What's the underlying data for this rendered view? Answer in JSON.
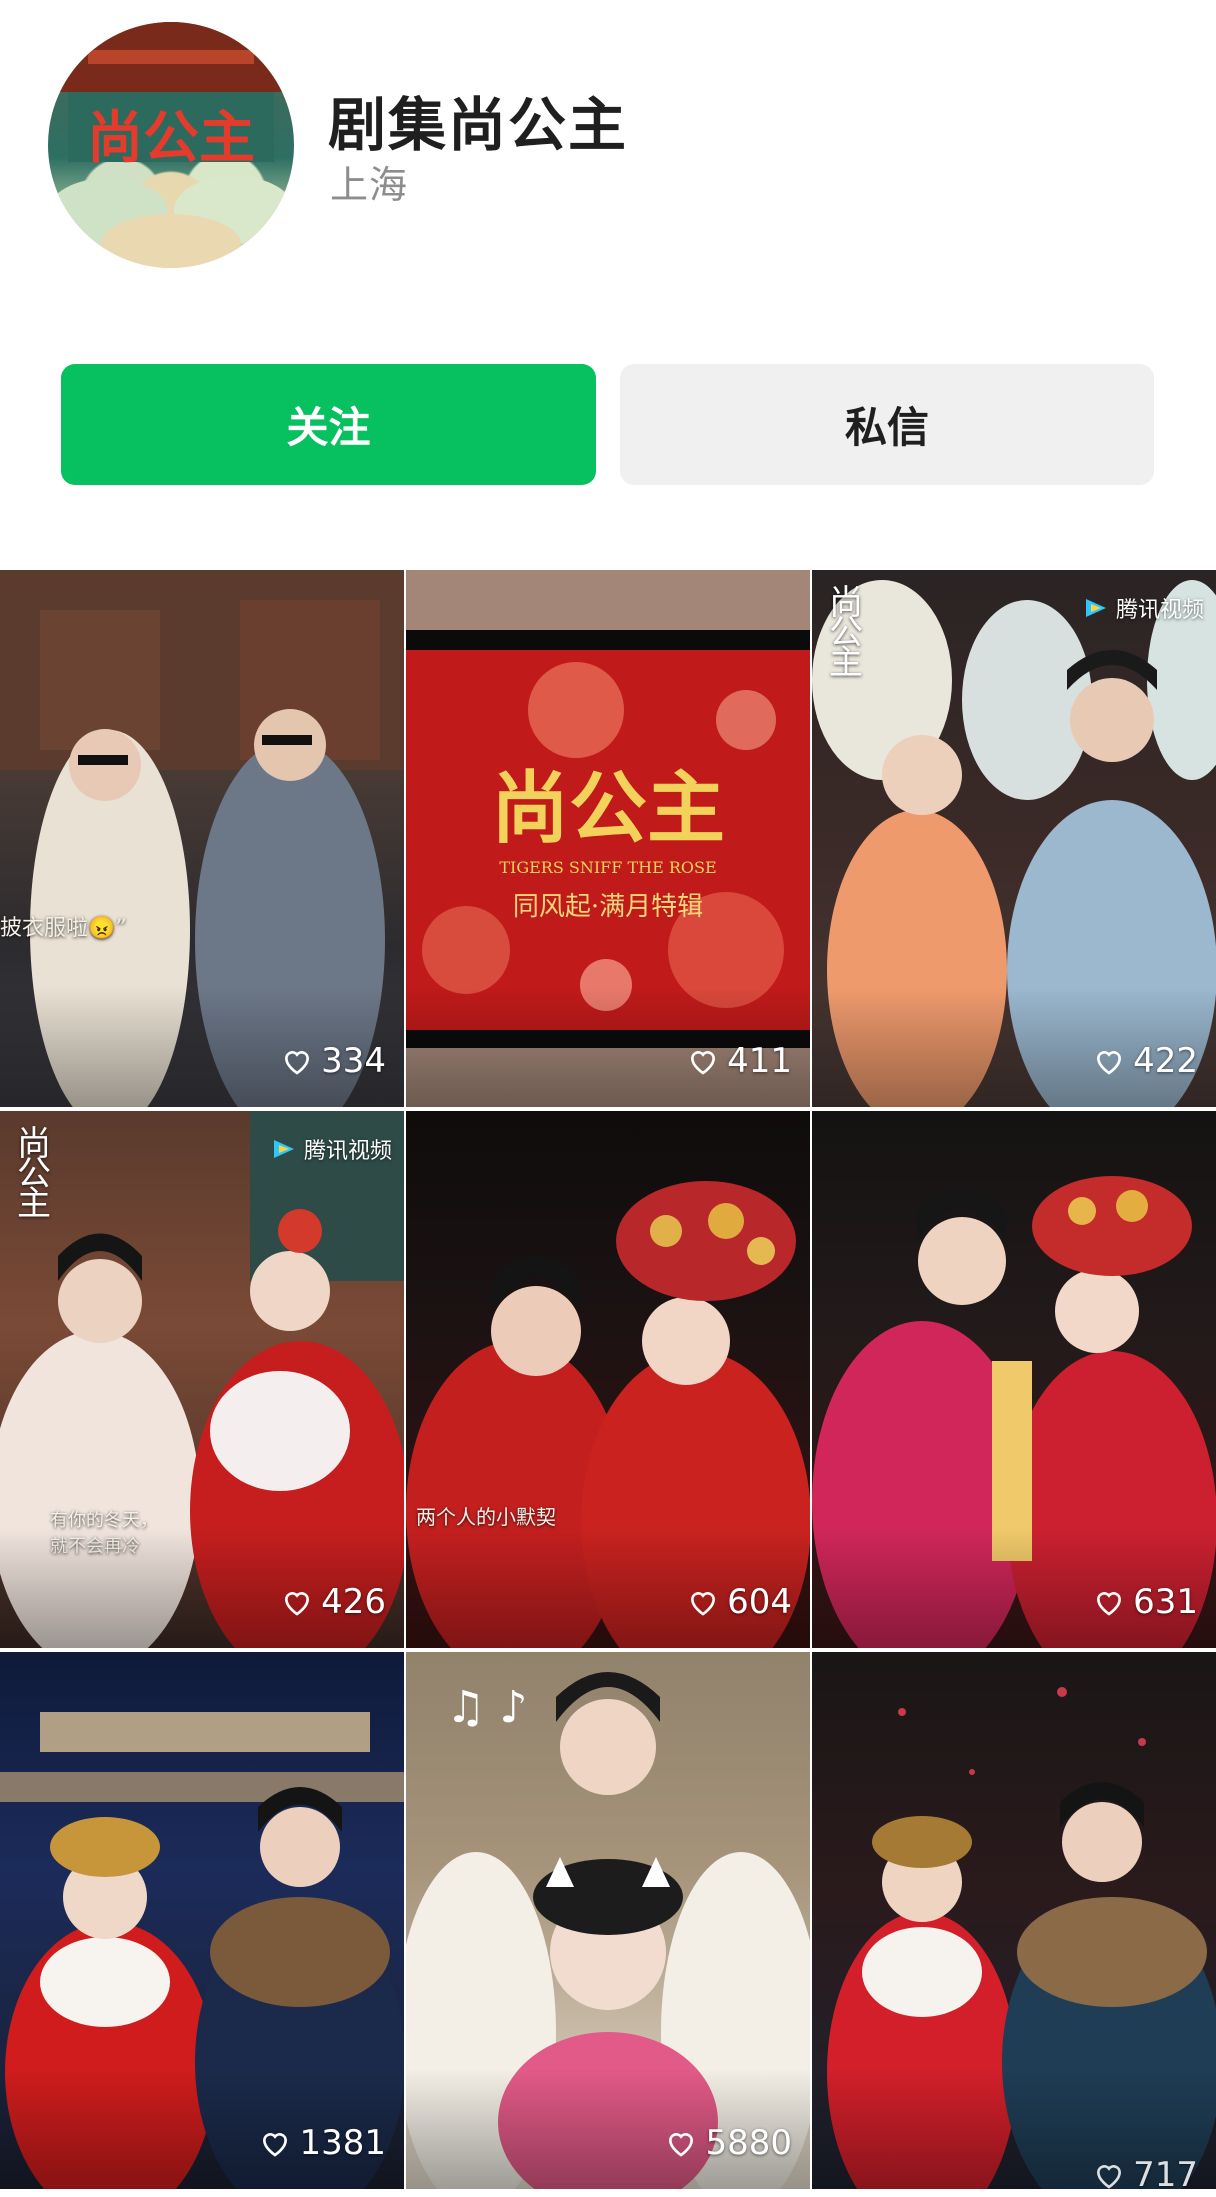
{
  "profile": {
    "name": "剧集尚公主",
    "location": "上海",
    "avatar_text": "尚公主"
  },
  "actions": {
    "follow_label": "关注",
    "message_label": "私信"
  },
  "colors": {
    "follow_bg": "#07c160",
    "message_bg": "#f0f0f0"
  },
  "posts": [
    {
      "likes": "334",
      "caption": "披衣服啦😠”"
    },
    {
      "likes": "411",
      "title": "尚公主",
      "subtitle": "TIGERS SNIFF THE ROSE",
      "caption": "同风起·满月特辑"
    },
    {
      "likes": "422",
      "badge": "腾讯视频",
      "corner": "尚公主"
    },
    {
      "likes": "426",
      "badge": "腾讯视频",
      "corner": "尚公主",
      "caption": "有你的冬天，\n就不会再冷"
    },
    {
      "likes": "604",
      "caption": "两个人的小默契"
    },
    {
      "likes": "631"
    },
    {
      "likes": "1381"
    },
    {
      "likes": "5880"
    },
    {
      "likes": "717"
    }
  ]
}
